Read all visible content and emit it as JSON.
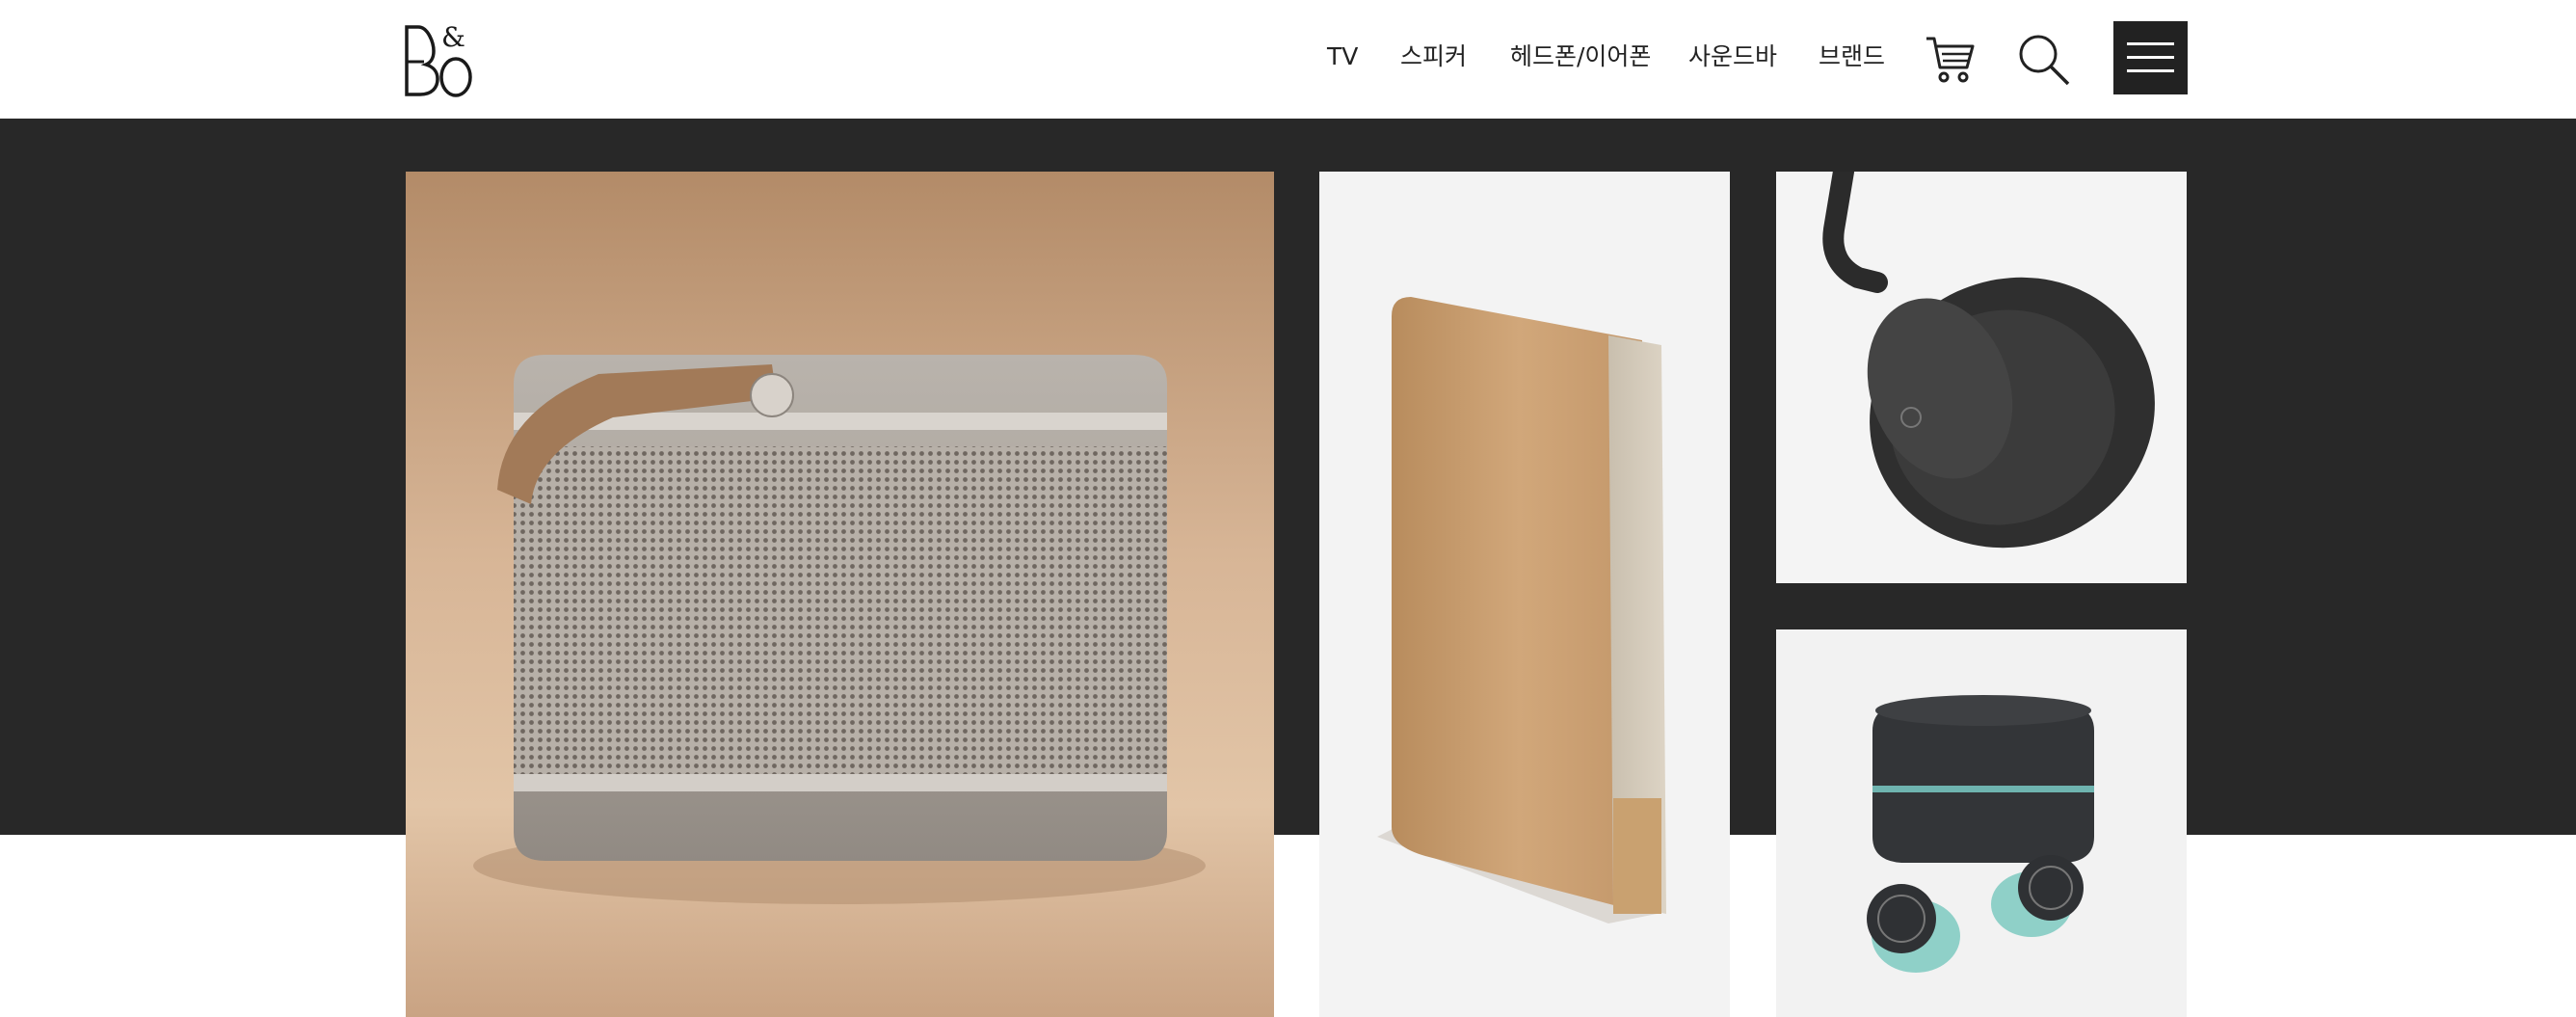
{
  "header": {
    "logo_alt": "B&O",
    "nav": [
      {
        "label": "TV"
      },
      {
        "label": "스피커"
      },
      {
        "label": "헤드폰/이어폰"
      },
      {
        "label": "사운드바"
      },
      {
        "label": "브랜드"
      }
    ],
    "icons": {
      "cart": "cart-icon",
      "search": "search-icon",
      "menu": "hamburger-menu-icon"
    }
  },
  "colors": {
    "header_bg": "#ffffff",
    "hero_bg": "#282828",
    "nav_text": "#222222",
    "menu_button_bg": "#222222"
  },
  "products": [
    {
      "name": "portable-speaker",
      "image": "beige portable speaker with leather strap"
    },
    {
      "name": "bookshelf-speaker",
      "image": "wooden tall speaker"
    },
    {
      "name": "headphones",
      "image": "dark over-ear headphones"
    },
    {
      "name": "earbuds",
      "image": "wireless earbuds with charging case"
    }
  ]
}
